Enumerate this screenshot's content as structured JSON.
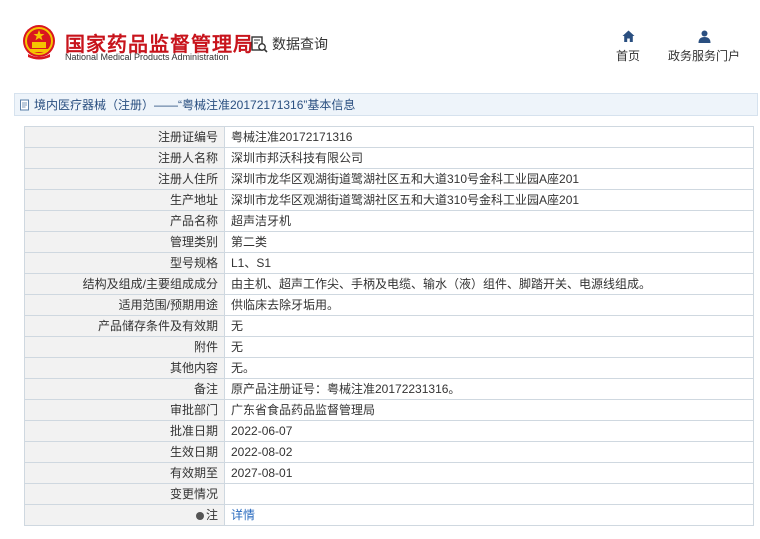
{
  "header": {
    "brand_cn": "国家药品监督管理局",
    "brand_en": "National Medical Products Administration",
    "query_label": "数据查询",
    "nav": {
      "home": "首页",
      "portal": "政务服务门户"
    }
  },
  "breadcrumb": {
    "text": "境内医疗器械（注册）——“粤械注准20172171316”基本信息"
  },
  "colors": {
    "brand_red": "#c8141c",
    "breadcrumb_text": "#2a4f80",
    "label_bg": "#f2f2f2",
    "link": "#2a6bbf"
  },
  "rows": [
    {
      "label": "注册证编号",
      "value": "粤械注准20172171316"
    },
    {
      "label": "注册人名称",
      "value": "深圳市邦沃科技有限公司"
    },
    {
      "label": "注册人住所",
      "value": "深圳市龙华区观湖街道鹭湖社区五和大道310号金科工业园A座201"
    },
    {
      "label": "生产地址",
      "value": "深圳市龙华区观湖街道鹭湖社区五和大道310号金科工业园A座201"
    },
    {
      "label": "产品名称",
      "value": "超声洁牙机"
    },
    {
      "label": "管理类别",
      "value": "第二类"
    },
    {
      "label": "型号规格",
      "value": "L1、S1"
    },
    {
      "label": "结构及组成/主要组成成分",
      "value": "由主机、超声工作尖、手柄及电缆、输水（液）组件、脚踏开关、电源线组成。"
    },
    {
      "label": "适用范围/预期用途",
      "value": "供临床去除牙垢用。"
    },
    {
      "label": "产品储存条件及有效期",
      "value": "无"
    },
    {
      "label": "附件",
      "value": "无"
    },
    {
      "label": "其他内容",
      "value": "无。"
    },
    {
      "label": "备注",
      "value": "原产品注册证号：粤械注准20172231316。"
    },
    {
      "label": "审批部门",
      "value": "广东省食品药品监督管理局"
    },
    {
      "label": "批准日期",
      "value": "2022-06-07"
    },
    {
      "label": "生效日期",
      "value": "2022-08-02"
    },
    {
      "label": "有效期至",
      "value": "2027-08-01"
    },
    {
      "label": "变更情况",
      "value": ""
    }
  ],
  "note_row": {
    "label": "注",
    "link": "详情"
  }
}
